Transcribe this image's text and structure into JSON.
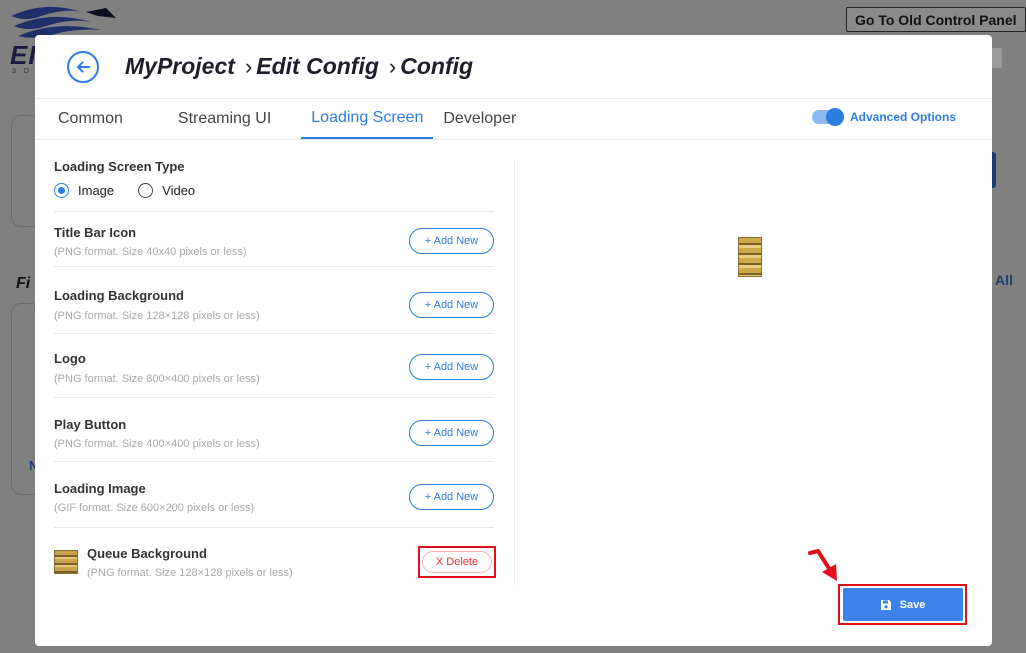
{
  "background": {
    "old_panel_button": "Go To Old Control Panel",
    "logo_letters": "EI",
    "logo_sub": "3 D",
    "section_fragment": "Fi",
    "view_all_fragment": "All",
    "side_fragment": "N"
  },
  "header": {
    "back_icon": "arrow-left-circle-icon",
    "breadcrumbs": [
      "MyProject",
      "Edit Config",
      "Config"
    ],
    "separator": "›"
  },
  "tabs": [
    {
      "label": "Common",
      "active": false
    },
    {
      "label": "Streaming UI",
      "active": false
    },
    {
      "label": "Loading Screen",
      "active": true
    },
    {
      "label": "Developer",
      "active": false
    }
  ],
  "advanced_options": {
    "label": "Advanced Options",
    "enabled": true
  },
  "loading_screen_type": {
    "label": "Loading Screen Type",
    "options": [
      {
        "label": "Image",
        "selected": true
      },
      {
        "label": "Video",
        "selected": false
      }
    ]
  },
  "assets": [
    {
      "label": "Title Bar Icon",
      "hint": "(PNG format. Size 40x40 pixels or less)",
      "action": "+ Add New"
    },
    {
      "label": "Loading Background",
      "hint": "(PNG format. Size 128×128 pixels or less)",
      "action": "+ Add New"
    },
    {
      "label": "Logo",
      "hint": "(PNG format. Size 800×400 pixels or less)",
      "action": "+ Add New"
    },
    {
      "label": "Play Button",
      "hint": "(PNG format. Size 400×400 pixels or less)",
      "action": "+ Add New"
    },
    {
      "label": "Loading Image",
      "hint": "(GIF format. Size 600×200 pixels or less)",
      "action": "+ Add New"
    }
  ],
  "queue_background": {
    "label": "Queue Background",
    "hint": "(PNG format. Size 128×128 pixels or less)",
    "action": "X Delete"
  },
  "save": {
    "label": "Save",
    "icon": "floppy-disk-icon"
  },
  "colors": {
    "accent": "#2d7ee0",
    "highlight": "#e00f1a",
    "save_bg": "#3d82ea"
  }
}
